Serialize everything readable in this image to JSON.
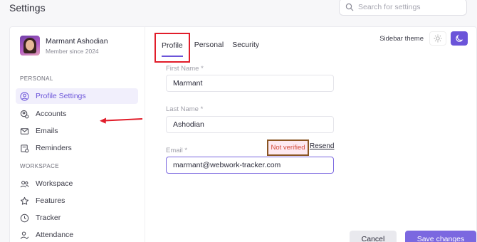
{
  "header": {
    "title": "Settings",
    "search_placeholder": "Search for settings"
  },
  "user": {
    "name": "Marmant Ashodian",
    "since": "Member since 2024"
  },
  "sidebar": {
    "personal_label": "PERSONAL",
    "workspace_label": "WORKSPACE",
    "personal_items": [
      {
        "label": "Profile Settings",
        "icon": "user-circle-icon",
        "active": true
      },
      {
        "label": "Accounts",
        "icon": "accounts-icon"
      },
      {
        "label": "Emails",
        "icon": "mail-icon"
      },
      {
        "label": "Reminders",
        "icon": "reminder-icon"
      }
    ],
    "workspace_items": [
      {
        "label": "Workspace",
        "icon": "users-icon"
      },
      {
        "label": "Features",
        "icon": "star-icon"
      },
      {
        "label": "Tracker",
        "icon": "clock-icon"
      },
      {
        "label": "Attendance",
        "icon": "attendance-icon"
      }
    ]
  },
  "tabs": [
    {
      "label": "Profile",
      "active": true
    },
    {
      "label": "Personal"
    },
    {
      "label": "Security"
    }
  ],
  "theme": {
    "label": "Sidebar theme",
    "selected": "dark"
  },
  "form": {
    "first_name_label": "First Name *",
    "first_name_value": "Marmant",
    "last_name_label": "Last Name *",
    "last_name_value": "Ashodian",
    "email_label": "Email *",
    "email_value": "marmant@webwork-tracker.com",
    "not_verified": "Not verified",
    "resend": "Resend"
  },
  "actions": {
    "cancel": "Cancel",
    "save": "Save changes"
  },
  "colors": {
    "accent": "#6b54d9",
    "annotation_red": "#e11d2a",
    "annotation_brown": "#8a5523"
  }
}
